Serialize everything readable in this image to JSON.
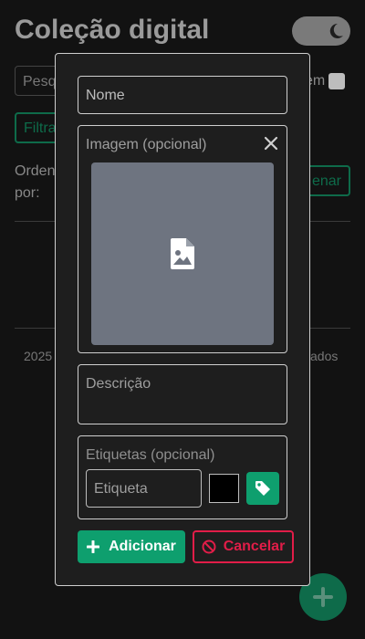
{
  "background": {
    "title": "Coleção digital",
    "theme_toggle_icon": "moon-icon",
    "search_placeholder": "Pesq",
    "em_label": "em",
    "filter_label": "Filtra",
    "order_label_1": "Orden",
    "order_label_2": "por:",
    "order_button": "enar",
    "footer_left": "2025",
    "footer_right": "vados",
    "fab_icon": "plus-icon"
  },
  "modal": {
    "name_placeholder": "Nome",
    "image_label": "Imagem (opcional)",
    "image_icon": "file-image-icon",
    "close_icon": "close-icon",
    "description_placeholder": "Descrição",
    "tags_label": "Etiquetas (opcional)",
    "tag_placeholder": "Etiqueta",
    "tag_color": "#000000",
    "tag_add_icon": "tag-icon",
    "add_label": "Adicionar",
    "cancel_label": "Cancelar"
  },
  "colors": {
    "accent": "#0e9f6e",
    "danger": "#e11d48",
    "background": "#121212"
  }
}
